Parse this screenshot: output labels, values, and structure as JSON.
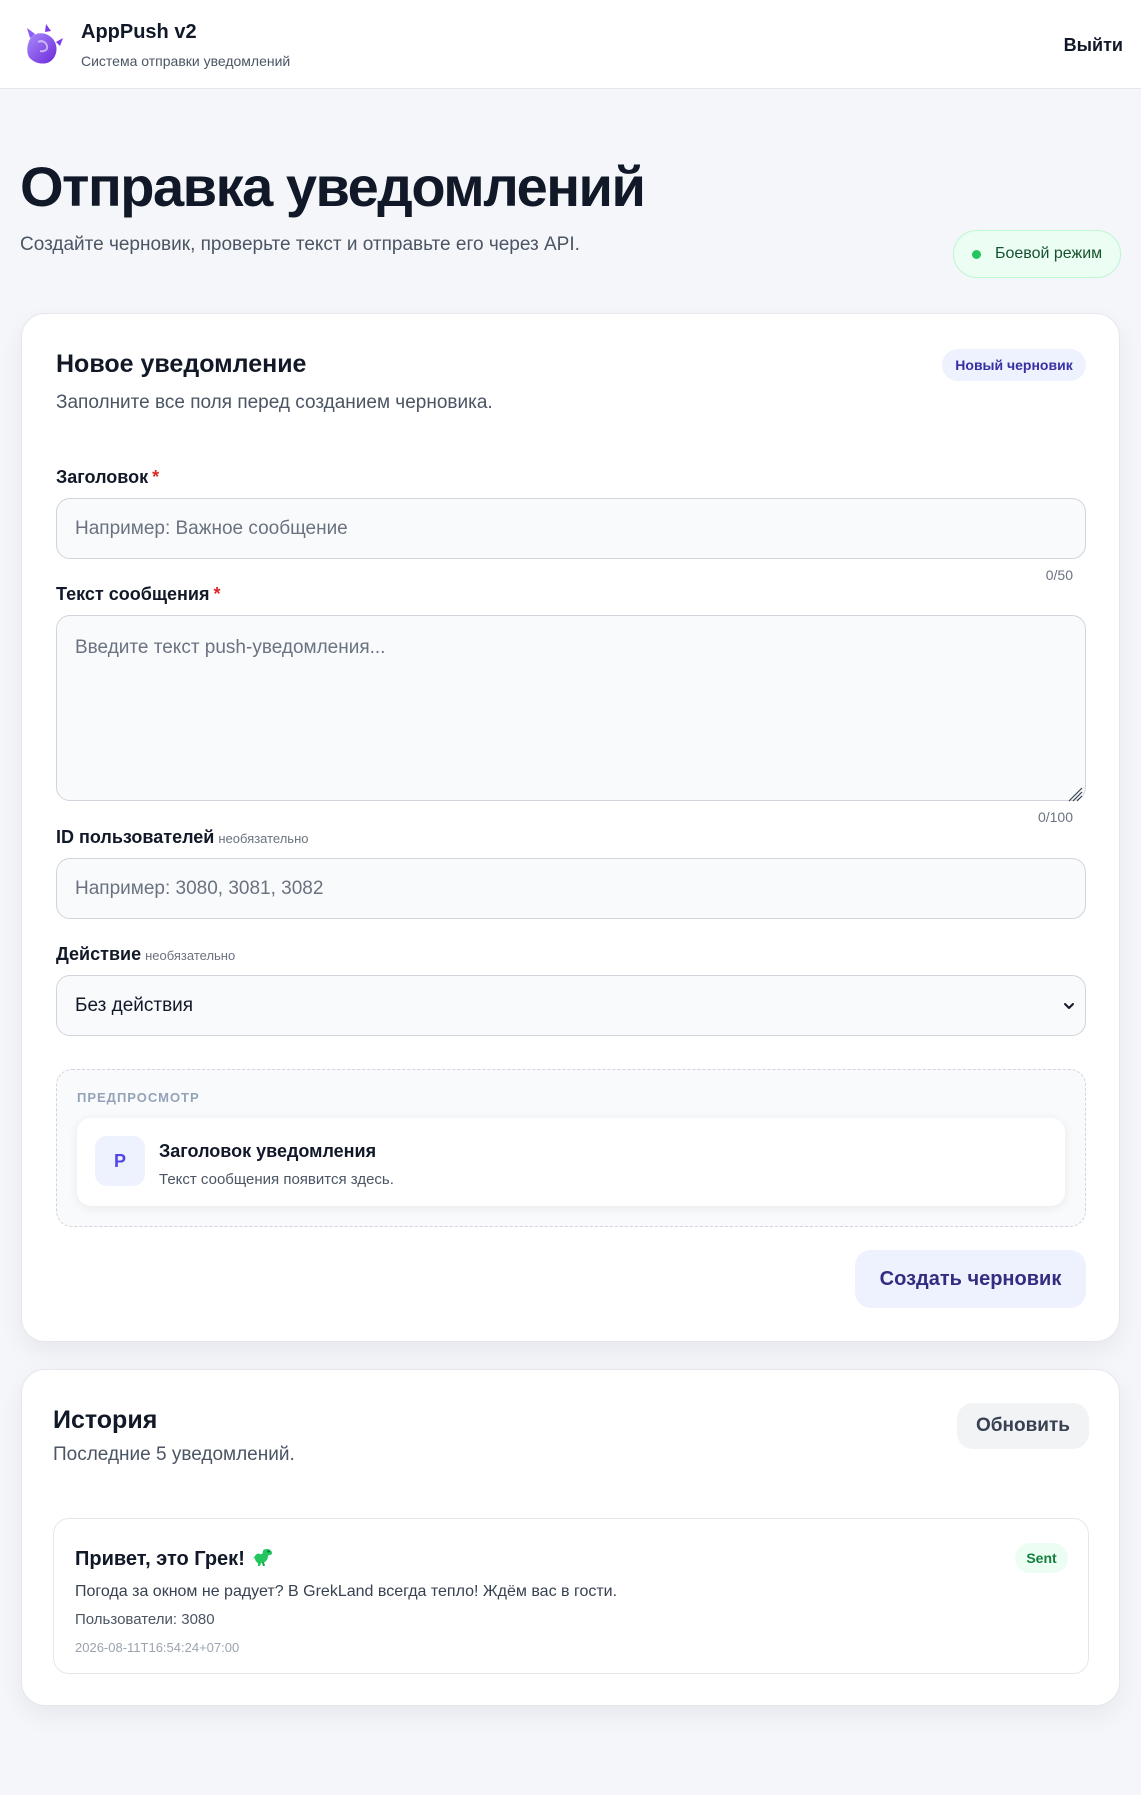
{
  "header": {
    "app_name": "AppPush v2",
    "app_subtitle": "Система отправки уведомлений",
    "logout_label": "Выйти"
  },
  "page": {
    "title": "Отправка уведомлений",
    "subtitle": "Создайте черновик, проверьте текст и отправьте его через API.",
    "mode_label": "Боевой режим",
    "mode_color": "#22c55e"
  },
  "form": {
    "title": "Новое уведомление",
    "description": "Заполните все поля перед созданием черновика.",
    "badge": "Новый черновик",
    "fields": {
      "title": {
        "label": "Заголовок",
        "required_mark": "*",
        "placeholder": "Например: Важное сообщение",
        "value": "",
        "counter": "0/50"
      },
      "message": {
        "label": "Текст сообщения",
        "required_mark": "*",
        "placeholder": "Введите текст push-уведомления...",
        "value": "",
        "counter": "0/100"
      },
      "user_ids": {
        "label": "ID пользователей",
        "optional_label": "необязательно",
        "placeholder": "Например: 3080, 3081, 3082",
        "value": ""
      },
      "action": {
        "label": "Действие",
        "optional_label": "необязательно",
        "selected": "Без действия"
      }
    },
    "preview": {
      "label": "ПРЕДПРОСМОТР",
      "avatar_letter": "P",
      "title": "Заголовок уведомления",
      "text": "Текст сообщения появится здесь."
    },
    "submit_label": "Создать черновик"
  },
  "history": {
    "title": "История",
    "description": "Последние 5 уведомлений.",
    "refresh_label": "Обновить",
    "items": [
      {
        "title": "Привет, это Грек!",
        "emoji_icon": "dinosaur-icon",
        "text": "Погода за окном не радует? В GrekLand всегда тепло! Ждём вас в гости.",
        "users": "Пользователи: 3080",
        "date": "2026-08-11T16:54:24+07:00",
        "status": "Sent"
      }
    ]
  },
  "colors": {
    "accent": "#4f46e5",
    "accent_bg": "#eef2ff",
    "success": "#15803d",
    "success_bg": "#ecfdf3",
    "required": "#dc2626"
  }
}
